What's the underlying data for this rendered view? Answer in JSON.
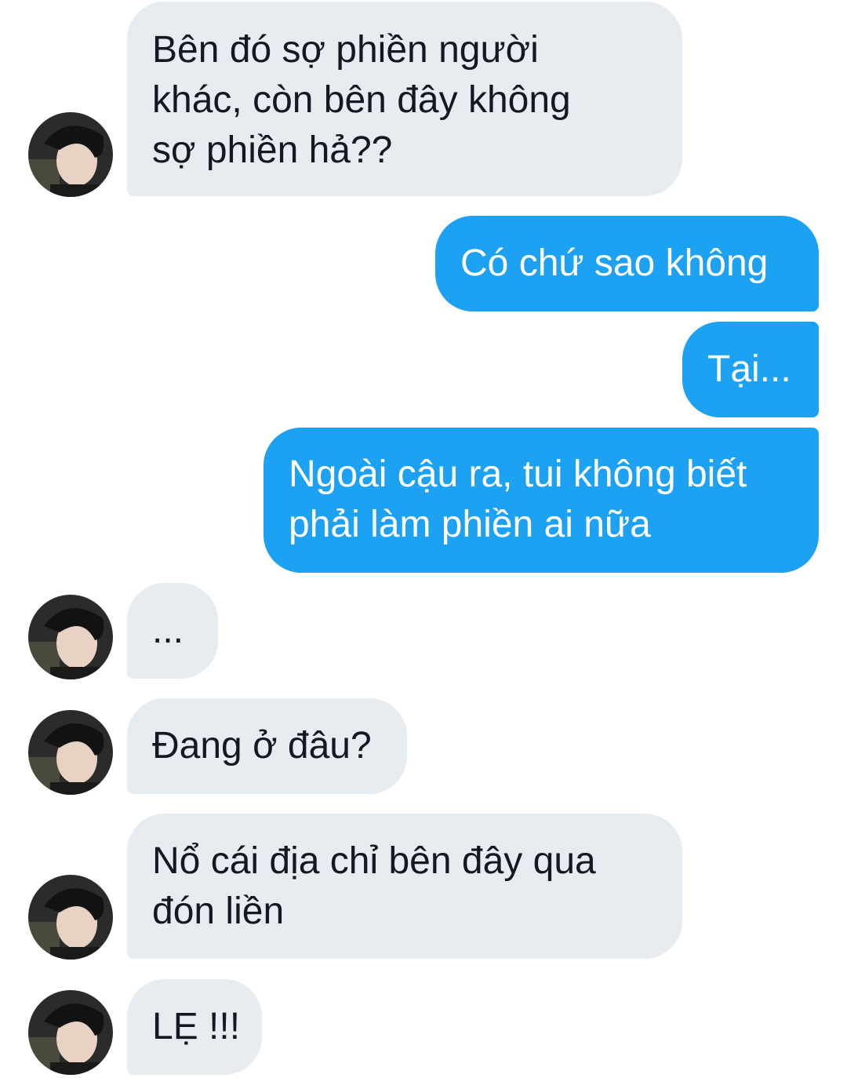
{
  "conversation": {
    "messages": [
      {
        "sender": "other",
        "lines": [
          "Bên đó sợ phiền người",
          "khác, còn bên đây không",
          "sợ phiền hả??"
        ]
      },
      {
        "sender": "me",
        "lines": [
          "Có chứ sao không"
        ]
      },
      {
        "sender": "me",
        "lines": [
          "Tại..."
        ]
      },
      {
        "sender": "me",
        "lines": [
          "Ngoài cậu ra, tui không biết",
          "phải làm phiền ai nữa"
        ]
      },
      {
        "sender": "other",
        "lines": [
          "..."
        ]
      },
      {
        "sender": "other",
        "lines": [
          "Đang ở đâu?"
        ]
      },
      {
        "sender": "other",
        "lines": [
          "Nổ cái địa chỉ bên đây qua",
          "đón liền"
        ]
      },
      {
        "sender": "other",
        "lines": [
          "LẸ !!!"
        ]
      }
    ]
  },
  "avatar": {
    "icon": "profile-photo-icon"
  },
  "colors": {
    "incoming_bubble": "#e6ecf0",
    "outgoing_bubble": "#1da1f2",
    "incoming_text": "#141823",
    "outgoing_text": "#ffffff"
  }
}
